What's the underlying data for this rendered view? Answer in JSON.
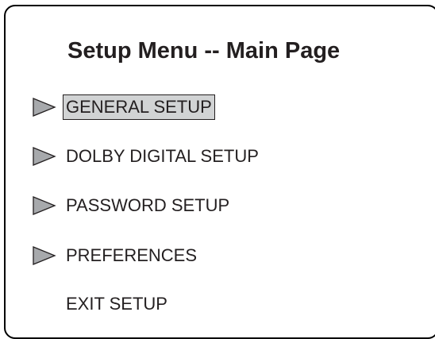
{
  "title": "Setup Menu -- Main Page",
  "menu": {
    "items": [
      {
        "label": "GENERAL SETUP",
        "selected": true,
        "arrow": true
      },
      {
        "label": "DOLBY DIGITAL SETUP",
        "selected": false,
        "arrow": true
      },
      {
        "label": "PASSWORD SETUP",
        "selected": false,
        "arrow": true
      },
      {
        "label": "PREFERENCES",
        "selected": false,
        "arrow": true
      },
      {
        "label": "EXIT SETUP",
        "selected": false,
        "arrow": false
      }
    ]
  },
  "colors": {
    "text": "#231f20",
    "arrow_fill": "#a7a9ac",
    "highlight": "#d1d3d4",
    "border": "#000000"
  }
}
